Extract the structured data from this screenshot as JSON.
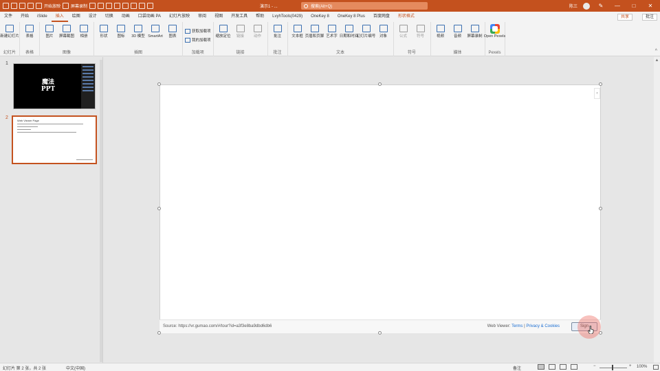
{
  "titlebar": {
    "qat_labels": [
      "开始放映",
      "屏幕录制"
    ],
    "title": "演示1 - ...",
    "search_placeholder": "搜索(Alt+Q)",
    "user": "陈三",
    "controls": [
      "—",
      "□",
      "✕"
    ]
  },
  "tabs": [
    "文件",
    "开始",
    "iSlide",
    "插入",
    "绘图",
    "设计",
    "切换",
    "动画",
    "口袋动画 PA",
    "幻灯片放映",
    "审阅",
    "视图",
    "开发工具",
    "帮助",
    "LvyhTools(0429)",
    "OneKey 8",
    "OneKey 8 Plus",
    "百度网盘",
    "形状格式"
  ],
  "active_tab": "插入",
  "share_label": "共享",
  "comment_label": "批注",
  "ribbon": {
    "groups": [
      {
        "name": "幻灯片",
        "buttons": [
          "新建幻灯片"
        ]
      },
      {
        "name": "表格",
        "buttons": [
          "表格"
        ]
      },
      {
        "name": "图像",
        "buttons": [
          "图片",
          "屏幕截图",
          "相册"
        ]
      },
      {
        "name": "插图",
        "buttons": [
          "形状",
          "图标",
          "3D 模型",
          "SmartArt",
          "图表"
        ]
      },
      {
        "name": "加载项",
        "small": [
          "获取加载项",
          "我的加载项"
        ]
      },
      {
        "name": "链接",
        "buttons": [
          "缩放定位",
          "链接",
          "动作"
        ]
      },
      {
        "name": "批注",
        "buttons": [
          "批注"
        ]
      },
      {
        "name": "文本",
        "buttons": [
          "文本框",
          "页眉和页脚",
          "艺术字",
          "日期和时间",
          "幻灯片编号",
          "对象"
        ]
      },
      {
        "name": "符号",
        "buttons": [
          "公式",
          "符号"
        ]
      },
      {
        "name": "媒体",
        "buttons": [
          "视频",
          "音频",
          "屏幕录制"
        ]
      },
      {
        "name": "Pexels",
        "buttons": [
          "Open Pexels"
        ]
      }
    ]
  },
  "thumbnails": [
    {
      "number": "1",
      "title_line1": "魔法",
      "title_line2": "PPT"
    },
    {
      "number": "2",
      "heading": "Web Viewer Page"
    }
  ],
  "footer": {
    "source": "Source: https://vr.gumao.com/#/tour?id=a3f3e8ba9dbd6db6",
    "web_viewer": "Web Viewer:",
    "terms": "Terms",
    "sep": "|",
    "privacy": "Privacy & Cookies",
    "button": "Sign"
  },
  "status": {
    "slide_info": "幻灯片 第 2 张，共 2 张",
    "language": "中文(中国)",
    "notes": "备注",
    "zoom": "100%"
  }
}
